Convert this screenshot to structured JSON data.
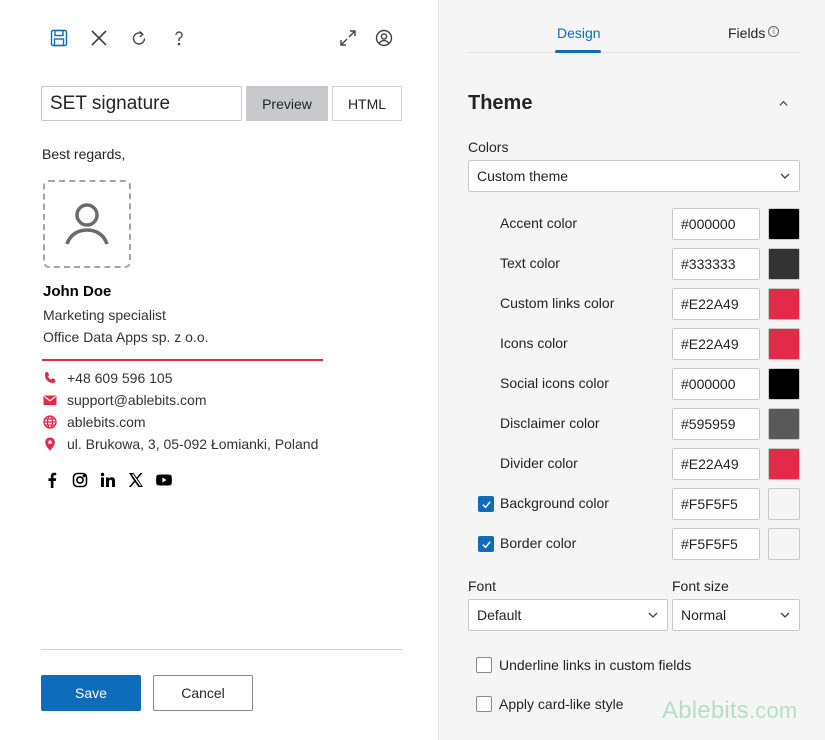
{
  "toolbar": {
    "save_icon": "save-icon",
    "close_icon": "close-icon",
    "refresh_icon": "refresh-icon",
    "help_icon": "help-icon",
    "expand_icon": "expand-icon",
    "account_icon": "account-icon"
  },
  "editor": {
    "signature_name": "SET signature",
    "preview_label": "Preview",
    "html_label": "HTML"
  },
  "signature": {
    "greeting": "Best regards,",
    "name": "John Doe",
    "title": "Marketing specialist",
    "company": "Office Data Apps sp. z o.o.",
    "divider_color": "#E22A49",
    "phone": "+48 609 596 105",
    "email": "support@ablebits.com",
    "website": "ablebits.com",
    "address": "ul. Brukowa, 3, 05-092 Łomianki, Poland",
    "socials": [
      "facebook-icon",
      "instagram-icon",
      "linkedin-icon",
      "x-icon",
      "youtube-icon"
    ]
  },
  "footer": {
    "save_label": "Save",
    "cancel_label": "Cancel"
  },
  "panel": {
    "tabs": [
      {
        "label": "Design",
        "active": true
      },
      {
        "label": "Fields",
        "active": false
      }
    ],
    "section_title": "Theme",
    "colors_label": "Colors",
    "colors_value": "Custom theme",
    "color_rows": [
      {
        "label": "Accent color",
        "hex": "#000000",
        "swatch": "#000000",
        "checkbox": null
      },
      {
        "label": "Text color",
        "hex": "#333333",
        "swatch": "#333333",
        "checkbox": null
      },
      {
        "label": "Custom links color",
        "hex": "#E22A49",
        "swatch": "#E22A49",
        "checkbox": null
      },
      {
        "label": "Icons color",
        "hex": "#E22A49",
        "swatch": "#E22A49",
        "checkbox": null
      },
      {
        "label": "Social icons color",
        "hex": "#000000",
        "swatch": "#000000",
        "checkbox": null
      },
      {
        "label": "Disclaimer color",
        "hex": "#595959",
        "swatch": "#595959",
        "checkbox": null
      },
      {
        "label": "Divider color",
        "hex": "#E22A49",
        "swatch": "#E22A49",
        "checkbox": null
      },
      {
        "label": "Background color",
        "hex": "#F5F5F5",
        "swatch": "#F5F5F5",
        "checkbox": true
      },
      {
        "label": "Border color",
        "hex": "#F5F5F5",
        "swatch": "#F5F5F5",
        "checkbox": true
      }
    ],
    "font_label": "Font",
    "font_value": "Default",
    "font_size_label": "Font size",
    "font_size_value": "Normal",
    "underline_label": "Underline links in custom fields",
    "card_label": "Apply card-like style",
    "brand_name": "Ablebits",
    "brand_suffix": ".com"
  },
  "colors": {
    "accent_blue": "#0F6CBD",
    "brand_red": "#E22A49"
  }
}
